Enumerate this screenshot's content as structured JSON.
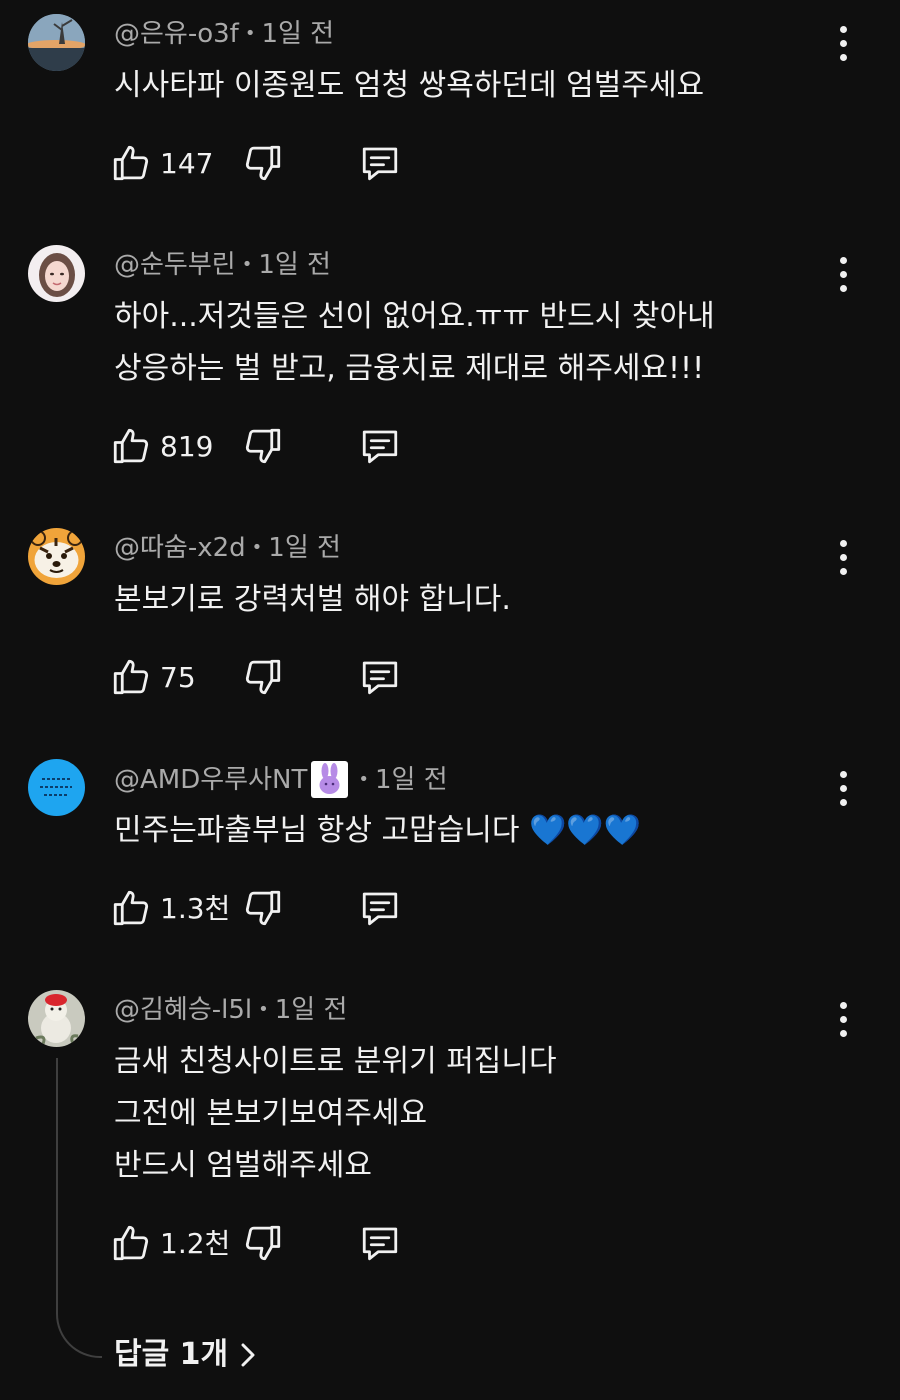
{
  "comments": [
    {
      "handle": "@은유-o3f",
      "time": "1일 전",
      "lines": [
        "시사타파 이종원도 엄청 쌍욕하던데 엄벌주세요"
      ],
      "likes": "147",
      "avatar_icon": "sunset-landscape-avatar"
    },
    {
      "handle": "@순두부린",
      "time": "1일 전",
      "lines": [
        "하아...저것들은 선이 없어요.ㅠㅠ 반드시 찾아내",
        "상응하는 벌 받고, 금융치료 제대로 해주세요!!!"
      ],
      "likes": "819",
      "avatar_icon": "illustrated-woman-avatar"
    },
    {
      "handle": "@따숨-x2d",
      "time": "1일 전",
      "lines": [
        "본보기로 강력처벌 해야 합니다."
      ],
      "likes": "75",
      "avatar_icon": "tiger-face-avatar"
    },
    {
      "handle": "@AMD우루사NT",
      "time": "1일 전",
      "lines": [
        "민주는파출부님 항상 고맙습니다 💙💙💙"
      ],
      "likes": "1.3천",
      "avatar_icon": "blue-text-avatar",
      "badge_icon": "purple-bunny-badge"
    },
    {
      "handle": "@김혜승-l5l",
      "time": "1일 전",
      "lines": [
        "금새 친청사이트로 분위기 퍼집니다",
        "그전에 본보기보여주세요",
        "반드시 엄벌해주세요"
      ],
      "likes": "1.2천",
      "avatar_icon": "snowman-avatar"
    }
  ],
  "replies_label": "답글 1개",
  "colors": {
    "background": "#0f0f0f",
    "text": "#f1f1f1",
    "meta": "#aaaaaa",
    "thread_line": "#3f3f3f"
  }
}
